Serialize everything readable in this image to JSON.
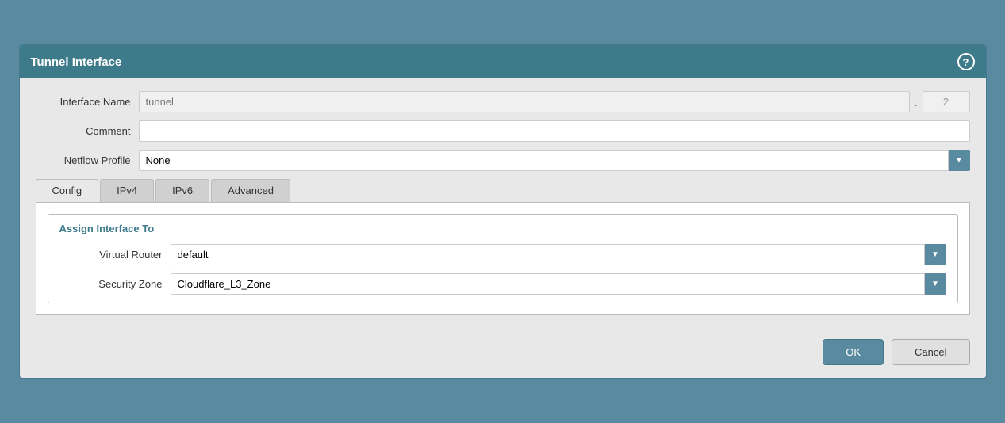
{
  "dialog": {
    "title": "Tunnel Interface",
    "help_icon_label": "?"
  },
  "form": {
    "interface_name_label": "Interface Name",
    "interface_name_placeholder": "tunnel",
    "interface_name_number": "2",
    "comment_label": "Comment",
    "comment_placeholder": "",
    "netflow_profile_label": "Netflow Profile",
    "netflow_profile_value": "None"
  },
  "tabs": [
    {
      "id": "config",
      "label": "Config",
      "active": true
    },
    {
      "id": "ipv4",
      "label": "IPv4",
      "active": false
    },
    {
      "id": "ipv6",
      "label": "IPv6",
      "active": false
    },
    {
      "id": "advanced",
      "label": "Advanced",
      "active": false
    }
  ],
  "config_tab": {
    "section_title": "Assign Interface To",
    "virtual_router_label": "Virtual Router",
    "virtual_router_value": "default",
    "security_zone_label": "Security Zone",
    "security_zone_value": "Cloudflare_L3_Zone"
  },
  "footer": {
    "ok_label": "OK",
    "cancel_label": "Cancel"
  }
}
